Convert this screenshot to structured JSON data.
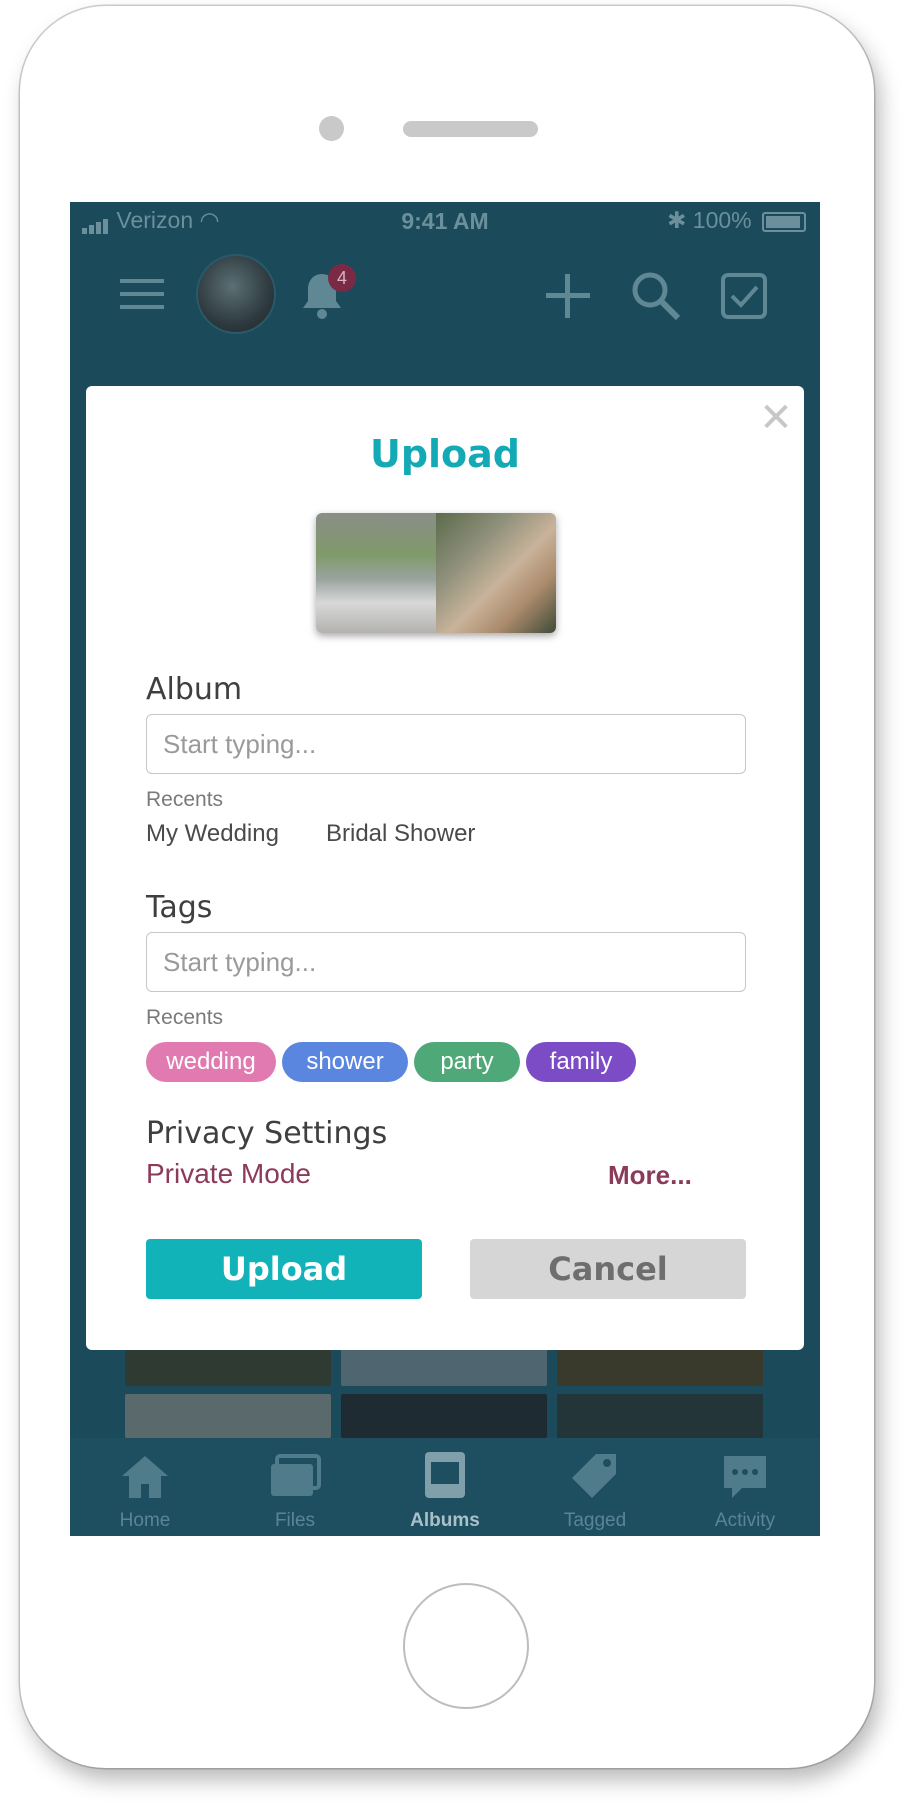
{
  "status_bar": {
    "carrier": "Verizon",
    "time": "9:41 AM",
    "battery": "100%"
  },
  "top_nav": {
    "notification_count": "4",
    "icons": [
      "menu-icon",
      "avatar",
      "bell-icon",
      "plus-icon",
      "search-icon",
      "checkbox-icon"
    ]
  },
  "modal": {
    "title": "Upload",
    "album": {
      "label": "Album",
      "placeholder": "Start typing...",
      "recents_label": "Recents",
      "recents": [
        "My Wedding",
        "Bridal Shower"
      ]
    },
    "tags": {
      "label": "Tags",
      "placeholder": "Start typing...",
      "recents_label": "Recents",
      "chips": [
        {
          "label": "wedding",
          "color": "#e07ab0"
        },
        {
          "label": "shower",
          "color": "#5b86e0"
        },
        {
          "label": "party",
          "color": "#4fa877"
        },
        {
          "label": "family",
          "color": "#7c4bc6"
        }
      ]
    },
    "privacy": {
      "label": "Privacy Settings",
      "mode": "Private Mode",
      "more": "More..."
    },
    "buttons": {
      "upload": "Upload",
      "cancel": "Cancel"
    }
  },
  "tab_bar": {
    "tabs": [
      {
        "label": "Home",
        "icon": "home-icon"
      },
      {
        "label": "Files",
        "icon": "images-icon"
      },
      {
        "label": "Albums",
        "icon": "album-icon",
        "active": true
      },
      {
        "label": "Tagged",
        "icon": "tag-icon"
      },
      {
        "label": "Activity",
        "icon": "chat-icon"
      }
    ]
  },
  "colors": {
    "accent": "#12b3b8",
    "overlay": "#1b4a5b",
    "privacy": "#8b3a5a"
  }
}
